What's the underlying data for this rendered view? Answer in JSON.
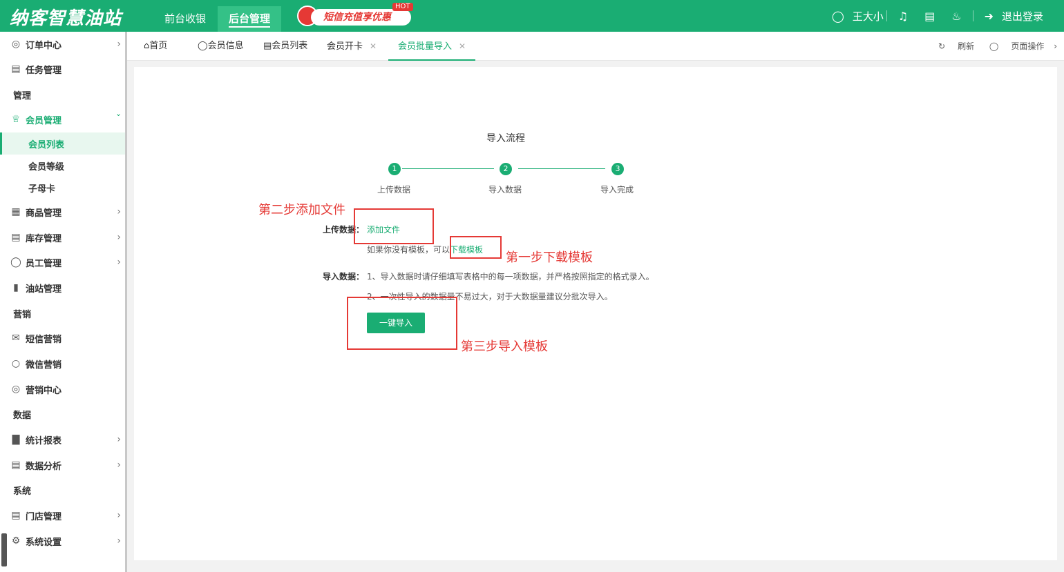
{
  "header": {
    "logo": "纳客智慧油站",
    "nav": [
      "前台收银",
      "后台管理"
    ],
    "promo": {
      "text": "短信充值享优惠",
      "badge": "HOT"
    },
    "user_name": "王大小",
    "logout": "退出登录",
    "colors": {
      "brand": "#1aad73",
      "promo": "#e53935"
    }
  },
  "sidebar": {
    "items": [
      {
        "label": "订单中心",
        "icon": "globe-icon"
      },
      {
        "label": "任务管理",
        "icon": "task-icon"
      },
      {
        "label": "管理"
      },
      {
        "label": "会员管理",
        "icon": "crown-icon"
      },
      {
        "label": "会员列表"
      },
      {
        "label": "会员等级"
      },
      {
        "label": "子母卡"
      },
      {
        "label": "商品管理",
        "icon": "grid-icon"
      },
      {
        "label": "库存管理",
        "icon": "box-icon"
      },
      {
        "label": "员工管理",
        "icon": "user-icon"
      },
      {
        "label": "油站管理",
        "icon": "fuel-icon"
      },
      {
        "label": "营销"
      },
      {
        "label": "短信营销",
        "icon": "mail-icon"
      },
      {
        "label": "微信营销",
        "icon": "wechat-icon"
      },
      {
        "label": "营销中心",
        "icon": "target-icon"
      },
      {
        "label": "数据"
      },
      {
        "label": "统计报表",
        "icon": "bar-chart-icon"
      },
      {
        "label": "数据分析",
        "icon": "monitor-chart-icon"
      },
      {
        "label": "系统"
      },
      {
        "label": "门店管理",
        "icon": "store-icon"
      },
      {
        "label": "系统设置",
        "icon": "gear-icon"
      }
    ]
  },
  "tabs": {
    "items": [
      "首页",
      "会员信息",
      "会员列表",
      "会员开卡",
      "会员批量导入"
    ],
    "refresh": "刷新",
    "page_ops": "页面操作"
  },
  "import": {
    "title": "导入流程",
    "steps": [
      {
        "num": "1",
        "label": "上传数据"
      },
      {
        "num": "2",
        "label": "导入数据"
      },
      {
        "num": "3",
        "label": "导入完成"
      }
    ],
    "upload_label": "上传数据：",
    "add_file": "添加文件",
    "no_template_prefix": "如果你没有模板，可以",
    "download_template": "下载模板",
    "import_label": "导入数据：",
    "note1": "1、导入数据时请仔细填写表格中的每一项数据，并严格按照指定的格式录入。",
    "note2": "2、一次性导入的数据量不易过大，对于大数据量建议分批次导入。",
    "button": "一键导入"
  },
  "annotations": {
    "step2": "第二步添加文件",
    "step1": "第一步下载模板",
    "step3": "第三步导入模板"
  }
}
